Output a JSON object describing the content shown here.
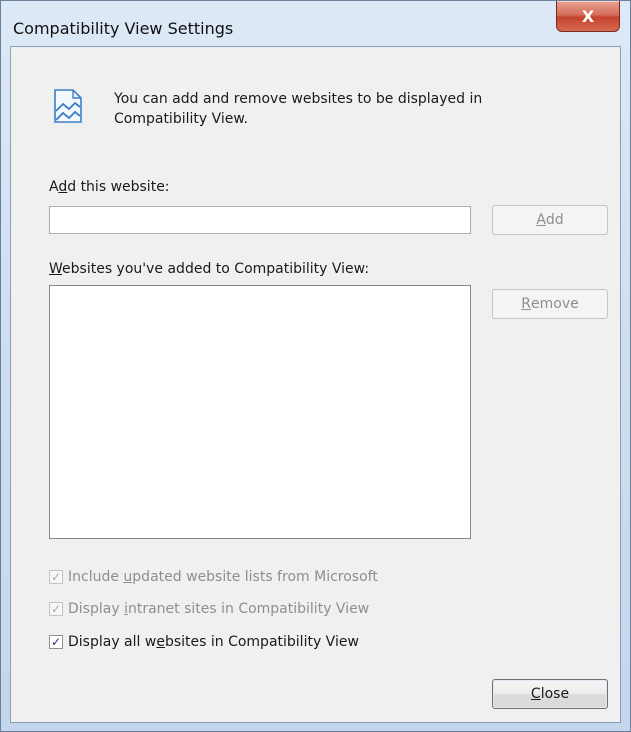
{
  "window": {
    "title": "Compatibility View Settings",
    "close_glyph": "X"
  },
  "info": {
    "icon": "compatibility-view-icon",
    "text": "You can add and remove websites to be displayed in Compatibility View."
  },
  "add_section": {
    "label_before": "A",
    "label_mnemonic": "d",
    "label_after": "d this website:",
    "input_value": "",
    "add_button_mnemonic": "A",
    "add_button_rest": "dd"
  },
  "list_section": {
    "label_mnemonic": "W",
    "label_rest": "ebsites you've added to Compatibility View:",
    "items": [],
    "remove_button_mnemonic": "R",
    "remove_button_rest": "emove"
  },
  "options": [
    {
      "before": "Include ",
      "mnemonic": "u",
      "after": "pdated website lists from Microsoft",
      "checked": true,
      "enabled": false
    },
    {
      "before": "Display ",
      "mnemonic": "i",
      "after": "ntranet sites in Compatibility View",
      "checked": true,
      "enabled": false
    },
    {
      "before": "Display all w",
      "mnemonic": "e",
      "after": "bsites in Compatibility View",
      "checked": true,
      "enabled": true
    }
  ],
  "footer": {
    "close_mnemonic": "C",
    "close_rest": "lose"
  },
  "colors": {
    "checkmark_enabled": "#1c2f8a",
    "disabled_text": "#8e8e8e",
    "close_button_red": "#c4442c"
  }
}
